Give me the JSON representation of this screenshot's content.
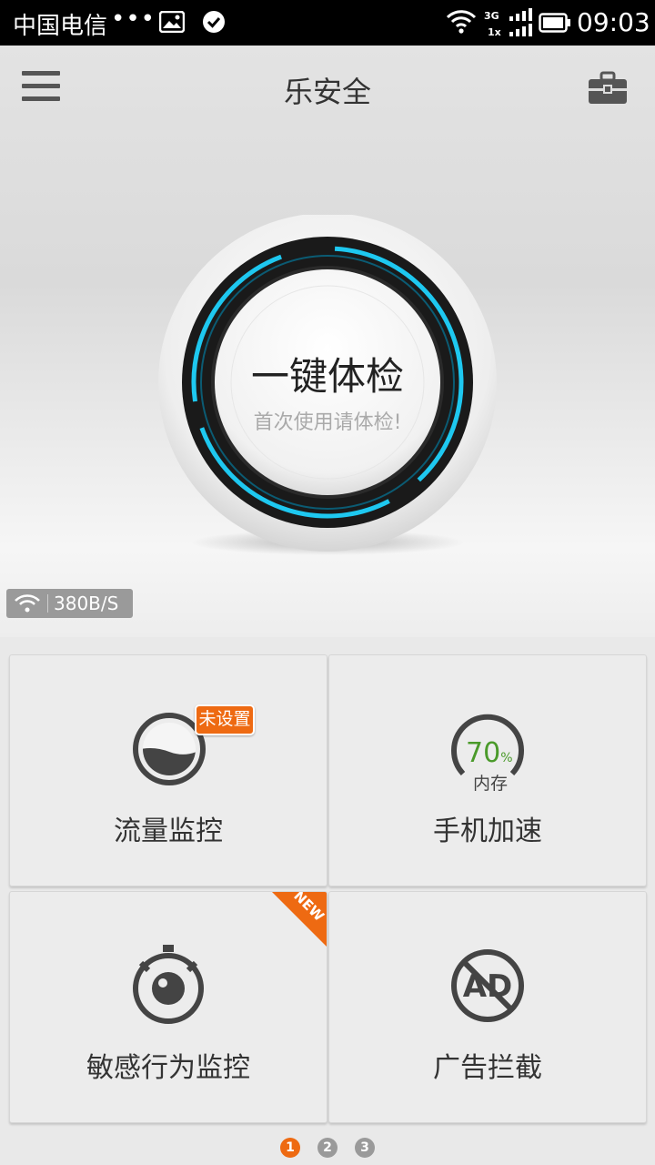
{
  "status_bar": {
    "carrier": "中国电信",
    "dots": "•••",
    "network_top": "3G",
    "network_bottom": "1x",
    "time": "09:03"
  },
  "header": {
    "title": "乐安全",
    "menu_icon": "hamburger-menu-icon",
    "toolbox_icon": "toolbox-icon"
  },
  "checkup": {
    "title": "一键体检",
    "subtitle": "首次使用请体检!",
    "ring_color": "#1ec8f0"
  },
  "network_speed": "380B/S",
  "tiles": [
    {
      "label": "流量监控",
      "badge": "未设置",
      "icon": "traffic-gauge-icon"
    },
    {
      "label": "手机加速",
      "memory_percent": "70",
      "percent_sign": "%",
      "memory_label": "内存",
      "icon": "memory-gauge-icon"
    },
    {
      "label": "敏感行为监控",
      "corner_badge": "NEW",
      "icon": "stopwatch-eye-icon"
    },
    {
      "label": "广告拦截",
      "ad_text": "AD",
      "icon": "ad-block-icon"
    }
  ],
  "pagination": {
    "pages": [
      "1",
      "2",
      "3"
    ],
    "active": 0
  },
  "colors": {
    "accent": "#ee6a12",
    "memory_green": "#4a9a2a",
    "dot_inactive": "#9a9a9a"
  }
}
